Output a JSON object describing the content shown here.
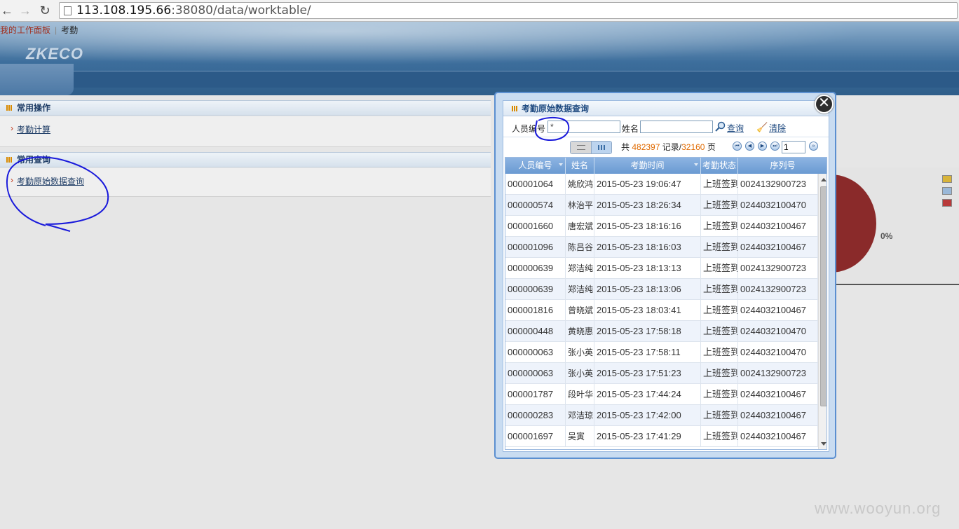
{
  "browser": {
    "url_host": "113.108.195.66",
    "url_rest": ":38080/data/worktable/"
  },
  "breadcrumb": {
    "home": "我的工作面板",
    "current": "考勤"
  },
  "logo": "ZKECO",
  "left_panels": {
    "common_ops": {
      "title": "常用操作",
      "link": "考勤计算"
    },
    "common_query": {
      "title": "常用查询",
      "link": "考勤原始数据查询"
    }
  },
  "background_chart": {
    "pie_label": "0%",
    "legend_colors": [
      "#d8b43a",
      "#9ab8d8",
      "#b83a3a"
    ]
  },
  "modal": {
    "title": "考勤原始数据查询",
    "close_icon": "close-icon",
    "query": {
      "pin_label": "人员编号",
      "pin_value": "*",
      "name_label": "姓名",
      "name_value": "",
      "search_label": "查询",
      "clear_label": "清除"
    },
    "pager": {
      "prefix": "共",
      "total_records": "482397",
      "records_word": "记录/",
      "total_pages": "32160",
      "pages_word": "页",
      "current_page": "1"
    },
    "columns": [
      "人员编号",
      "姓名",
      "考勤时间",
      "考勤状态",
      "序列号"
    ],
    "rows": [
      [
        "000001064",
        "姚欣鸿",
        "2015-05-23 19:06:47",
        "上班签到",
        "0024132900723"
      ],
      [
        "000000574",
        "林治平",
        "2015-05-23 18:26:34",
        "上班签到",
        "0244032100470"
      ],
      [
        "000001660",
        "唐宏斌",
        "2015-05-23 18:16:16",
        "上班签到",
        "0244032100467"
      ],
      [
        "000001096",
        "陈吕谷",
        "2015-05-23 18:16:03",
        "上班签到",
        "0244032100467"
      ],
      [
        "000000639",
        "郑洁纯",
        "2015-05-23 18:13:13",
        "上班签到",
        "0024132900723"
      ],
      [
        "000000639",
        "郑洁纯",
        "2015-05-23 18:13:06",
        "上班签到",
        "0024132900723"
      ],
      [
        "000001816",
        "曾晓斌",
        "2015-05-23 18:03:41",
        "上班签到",
        "0244032100467"
      ],
      [
        "000000448",
        "黄晓惠",
        "2015-05-23 17:58:18",
        "上班签到",
        "0244032100470"
      ],
      [
        "000000063",
        "张小英",
        "2015-05-23 17:58:11",
        "上班签到",
        "0244032100470"
      ],
      [
        "000000063",
        "张小英",
        "2015-05-23 17:51:23",
        "上班签到",
        "0024132900723"
      ],
      [
        "000001787",
        "段叶华",
        "2015-05-23 17:44:24",
        "上班签到",
        "0244032100467"
      ],
      [
        "000000283",
        "邓洁琼",
        "2015-05-23 17:42:00",
        "上班签到",
        "0244032100467"
      ],
      [
        "000001697",
        "吴寅",
        "2015-05-23 17:41:29",
        "上班签到",
        "0244032100467"
      ]
    ]
  },
  "watermark": "www.wooyun.org"
}
